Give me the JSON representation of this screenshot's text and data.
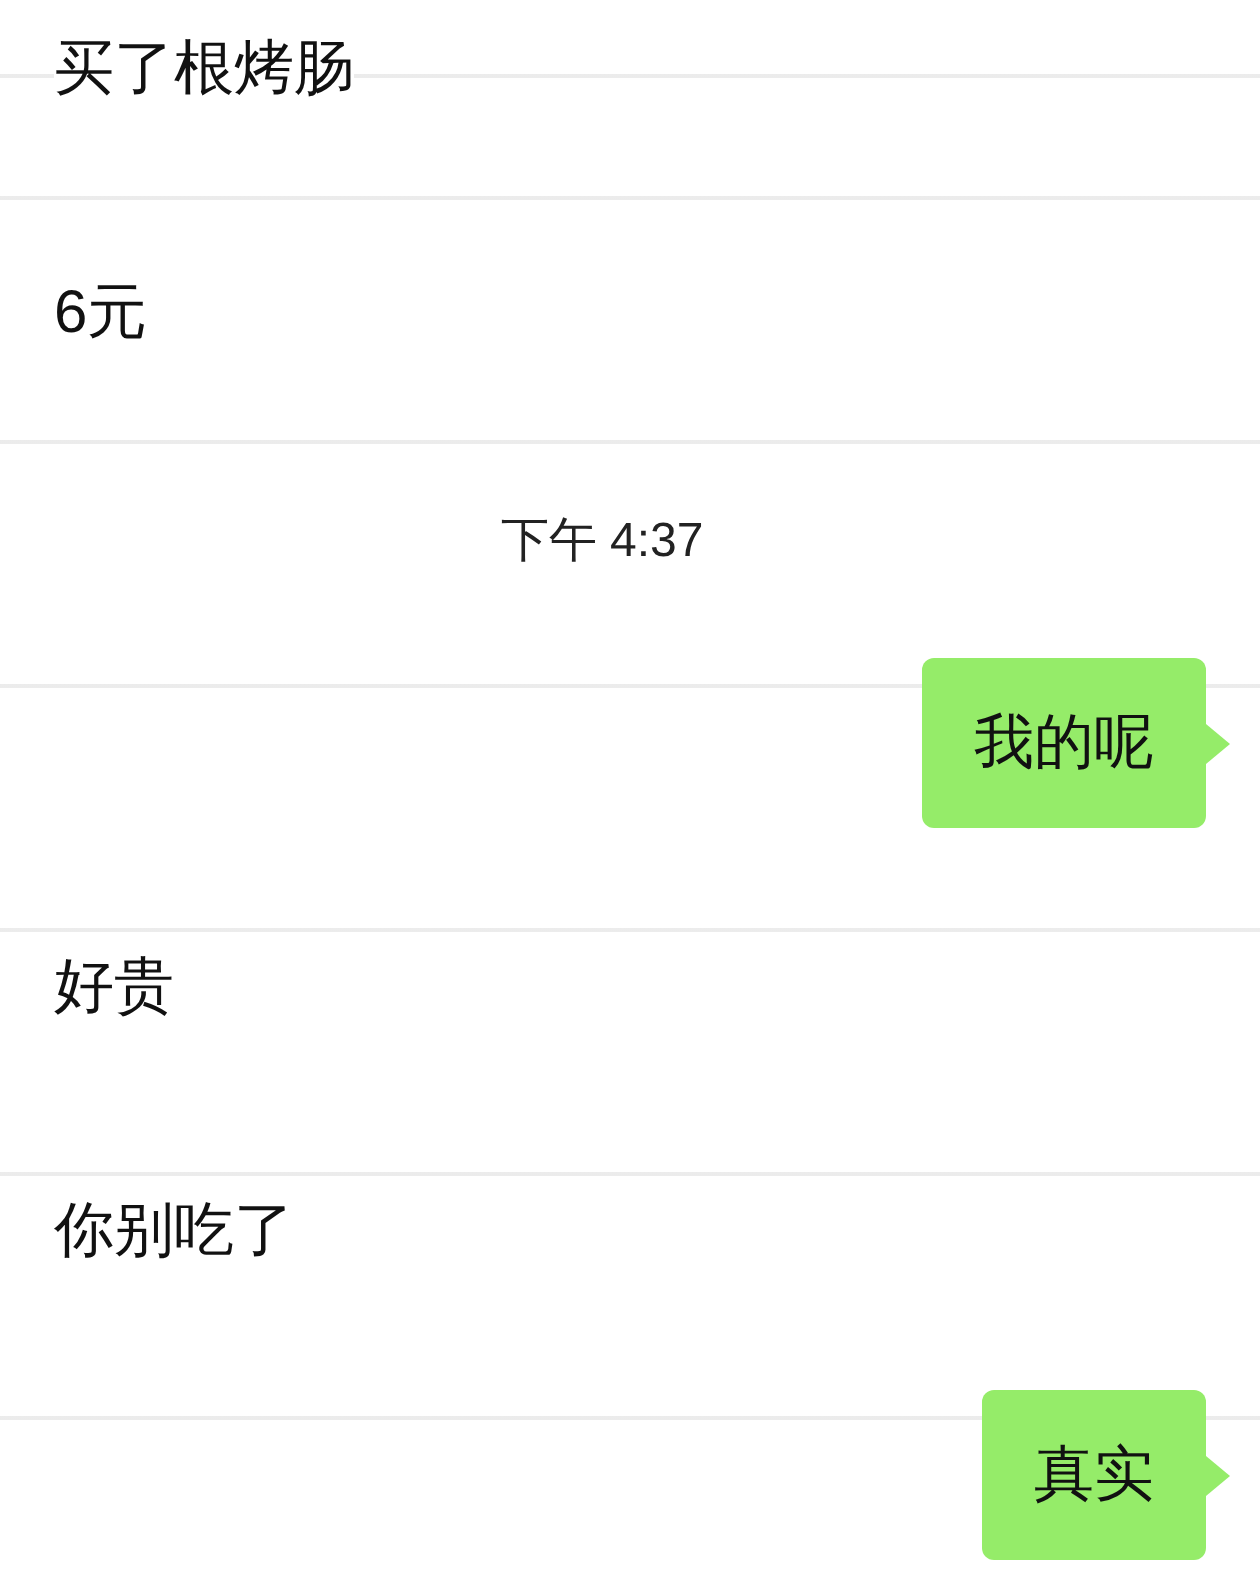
{
  "messages": [
    {
      "kind": "received",
      "text": "买了根烤肠"
    },
    {
      "kind": "received",
      "text": "6元"
    },
    {
      "kind": "time",
      "text": "下午 4:37"
    },
    {
      "kind": "sent",
      "text": "我的呢"
    },
    {
      "kind": "received",
      "text": "好贵"
    },
    {
      "kind": "received",
      "text": "你别吃了"
    },
    {
      "kind": "sent",
      "text": "真实"
    }
  ]
}
